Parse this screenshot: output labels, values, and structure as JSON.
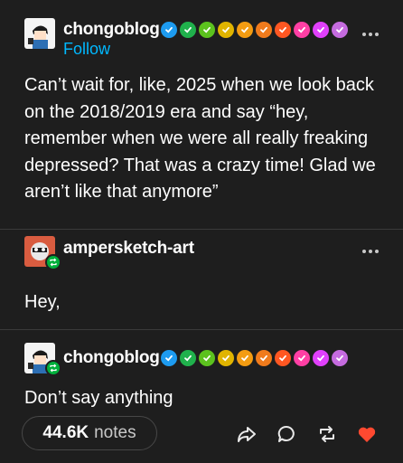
{
  "posts": [
    {
      "username": "chongoblog",
      "follow_label": "Follow",
      "text": "Can’t wait for, like, 2025 when we look back on the 2018/2019 era and say “hey, remember when we were all really freaking depressed? That was a crazy time! Glad we aren’t like that anymore”"
    },
    {
      "username": "ampersketch-art",
      "text": "Hey,"
    },
    {
      "username": "chongoblog",
      "text": "Don’t say anything"
    }
  ],
  "badge_colors": [
    "#1d9bf0",
    "#20b14c",
    "#5cc21e",
    "#e0b400",
    "#f39c12",
    "#f07b1c",
    "#ff5722",
    "#ff3fa4",
    "#e040fb",
    "#c56bdf"
  ],
  "footer": {
    "notes_count": "44.6K",
    "notes_label": "notes",
    "like_color": "#ff4930"
  },
  "icons": [
    "more-icon",
    "share-icon",
    "reply-icon",
    "reblog-icon",
    "heart-icon",
    "checkmark-icon"
  ]
}
